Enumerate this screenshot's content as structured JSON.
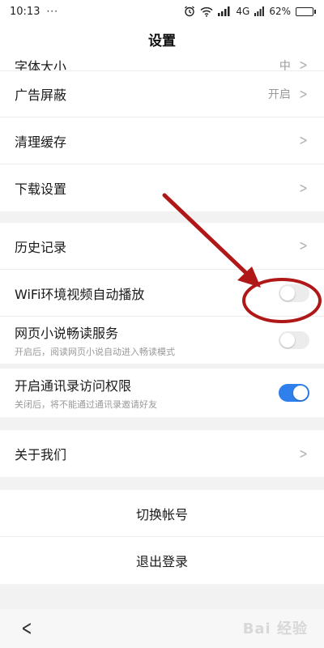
{
  "status_bar": {
    "time": "10:13",
    "dots": "···",
    "network": "4G",
    "battery": "62%",
    "battery_level": 0.62
  },
  "header": {
    "title": "设置"
  },
  "groups": {
    "g1": [
      {
        "label": "字体大小",
        "value": "中"
      },
      {
        "label": "广告屏蔽",
        "value": "开启"
      },
      {
        "label": "清理缓存",
        "value": ""
      },
      {
        "label": "下载设置",
        "value": ""
      }
    ],
    "g2": {
      "history": "历史记录",
      "wifi_autoplay": "WiFi环境视频自动播放",
      "novel": {
        "label": "网页小说畅读服务",
        "sub": "开启后，阅读网页小说自动进入畅读模式"
      }
    },
    "g3": {
      "label": "开启通讯录访问权限",
      "sub": "关闭后，将不能通过通讯录邀请好友"
    },
    "g4": {
      "about": "关于我们"
    },
    "g5": {
      "switch_account": "切换帐号",
      "logout": "退出登录"
    }
  },
  "toggles": {
    "wifi_autoplay": false,
    "novel": false,
    "contacts": true
  },
  "nav": {
    "watermark": "Bai 经验"
  },
  "colors": {
    "accent": "#2f80ed",
    "annotation": "#b01818"
  }
}
